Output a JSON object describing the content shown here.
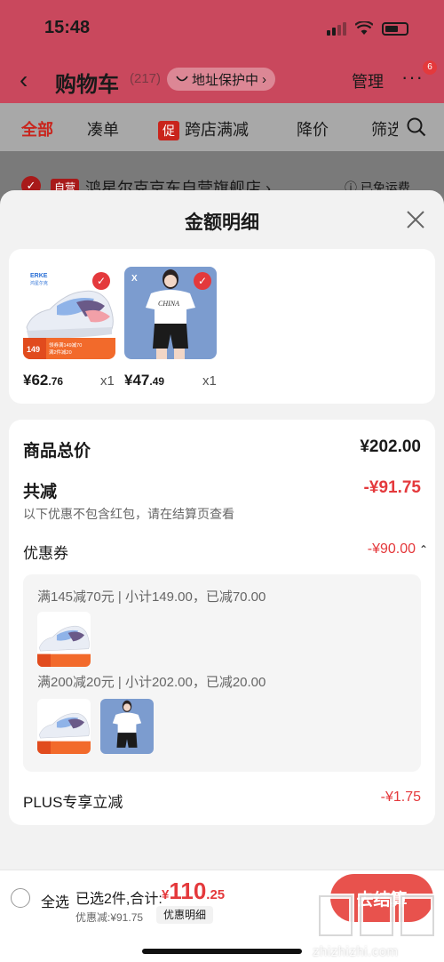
{
  "status_bar": {
    "time": "15:48"
  },
  "cart_nav": {
    "back_icon": "chevron-left-icon",
    "title": "购物车",
    "count": "(217)",
    "address_pill": "地址保护中",
    "address_chevron": "›",
    "manage": "管理",
    "more": "···",
    "more_badge": "6"
  },
  "filter_tabs": {
    "all": "全部",
    "bundle": "凑单",
    "promo_tag": "促",
    "cross_store": "跨店满减",
    "price_drop": "降价",
    "filter": "筛选"
  },
  "store": {
    "tag": "自营",
    "name": "鸿星尔克京东自营旗舰店 ›",
    "shipping": "ⓘ 已免运费"
  },
  "sheet": {
    "title": "金额明细",
    "close_icon": "close-icon"
  },
  "products": [
    {
      "brand": "ERKE",
      "brand_sub": "鸿星尔克",
      "promo_price": "149",
      "promo_line1": "领券满149减70",
      "promo_line2": "满2件减20",
      "price_main": "¥62",
      "price_decimal": ".76",
      "qty": "x1"
    },
    {
      "brand": "X",
      "shirt_text": "CHINA",
      "price_main": "¥47",
      "price_decimal": ".49",
      "qty": "x1"
    }
  ],
  "summary": {
    "goods_total_label": "商品总价",
    "goods_total_value": "¥202.00",
    "total_discount_label": "共减",
    "total_discount_value": "-¥91.75",
    "note": "以下优惠不包含红包，请在结算页查看",
    "coupon_label": "优惠券",
    "coupon_value": "-¥90.00",
    "coupon_chevron": "⌃",
    "coupon_groups": [
      {
        "text": "满145减70元 | 小计149.00，已减70.00"
      },
      {
        "text": "满200减20元 | 小计202.00，已减20.00"
      }
    ],
    "plus_label": "PLUS专享立减",
    "plus_value": "-¥1.75"
  },
  "bottom_bar": {
    "select_all": "全选",
    "selected": "已选2件,合计:",
    "total_currency": "¥",
    "total_int": "110",
    "total_dec": ".25",
    "discount": "优惠减:¥91.75",
    "detail_button": "优惠明细",
    "checkout": "去结算"
  },
  "watermark": {
    "site": "zhizhizhi.com",
    "logo_text": "值值值"
  },
  "colors": {
    "accent": "#e4393c",
    "dim_red": "#c9485d",
    "checkout": "#e8524d",
    "sheet_bg": "#f2f2f2"
  }
}
